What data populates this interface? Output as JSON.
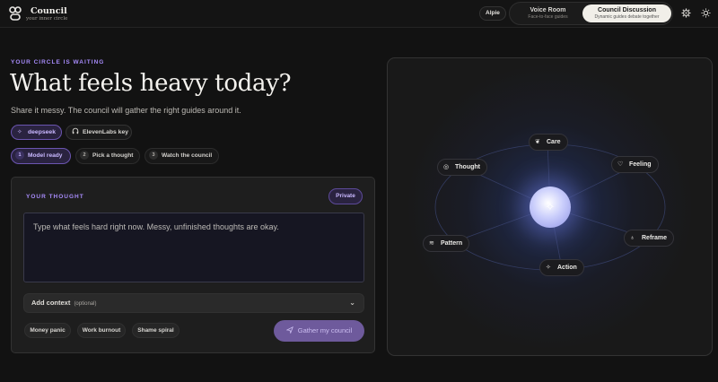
{
  "brand": {
    "title": "Council",
    "subtitle": "your inner circle"
  },
  "header": {
    "model_pill": "Alpie",
    "modes": [
      {
        "title": "Voice Room",
        "subtitle": "Face-to-face guides",
        "active": false
      },
      {
        "title": "Council Discussion",
        "subtitle": "Dynamic guides debate together",
        "active": true
      }
    ],
    "icons": [
      "gear-icon",
      "sun-icon"
    ]
  },
  "hero": {
    "eyebrow": "YOUR CIRCLE IS WAITING",
    "headline": "What feels heavy today?",
    "subline": "Share it messy. The council will gather the right guides around it."
  },
  "chips": {
    "provider": {
      "label": "deepseek",
      "icon": "sparkle-icon"
    },
    "elevenlabs": {
      "label": "ElevenLabs key",
      "icon": "headphones-icon"
    }
  },
  "steps": [
    {
      "num": "1",
      "label": "Model ready",
      "active": true
    },
    {
      "num": "2",
      "label": "Pick a thought",
      "active": false
    },
    {
      "num": "3",
      "label": "Watch the council",
      "active": false
    }
  ],
  "thought_card": {
    "label": "YOUR THOUGHT",
    "badge": "Private",
    "placeholder": "Type what feels hard right now. Messy, unfinished thoughts are okay.",
    "context_label": "Add context",
    "context_optional": "(optional)",
    "tags": [
      "Money panic",
      "Work burnout",
      "Shame spiral"
    ],
    "submit_label": "Gather my council"
  },
  "council": {
    "nodes": [
      {
        "label": "Care",
        "icon": "leaf-icon"
      },
      {
        "label": "Thought",
        "icon": "brain-icon"
      },
      {
        "label": "Feeling",
        "icon": "heart-icon"
      },
      {
        "label": "Pattern",
        "icon": "pattern-icon"
      },
      {
        "label": "Reframe",
        "icon": "lightbulb-icon"
      },
      {
        "label": "Action",
        "icon": "sparkle-icon"
      }
    ],
    "colors": {
      "accent": "#a78bfa",
      "core_glow": "#8f94e6"
    }
  }
}
